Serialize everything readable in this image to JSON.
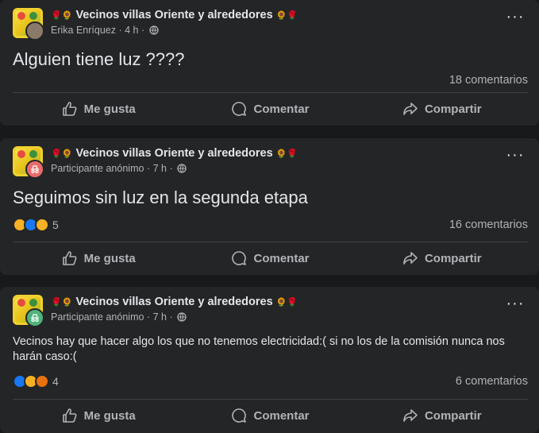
{
  "posts": [
    {
      "group_name": "Vecinos villas Oriente y alrededores",
      "author": "Erika Enríquez",
      "time": "4 h",
      "text": "Alguien tiene luz ????",
      "reactions_count": "",
      "comments": "18 comentarios"
    },
    {
      "group_name": "Vecinos villas Oriente y alrededores",
      "author": "Participante anónimo",
      "time": "7 h",
      "text": "Seguimos sin luz en la segunda etapa",
      "reactions_count": "5",
      "comments": "16 comentarios"
    },
    {
      "group_name": "Vecinos villas Oriente y alrededores",
      "author": "Participante anónimo",
      "time": "7 h",
      "text": "Vecinos hay que hacer algo los que no tenemos electricidad:( si no los de la comisión nunca nos harán caso:(",
      "reactions_count": "4",
      "comments": "6 comentarios"
    }
  ],
  "actions": {
    "like": "Me gusta",
    "comment": "Comentar",
    "share": "Compartir"
  },
  "separator": "·",
  "icons": {
    "flower_left": "rose-sunflower-emoji",
    "flower_right": "sunflower-rose-emoji",
    "privacy": "globe-icon",
    "more": "more-options-icon"
  }
}
